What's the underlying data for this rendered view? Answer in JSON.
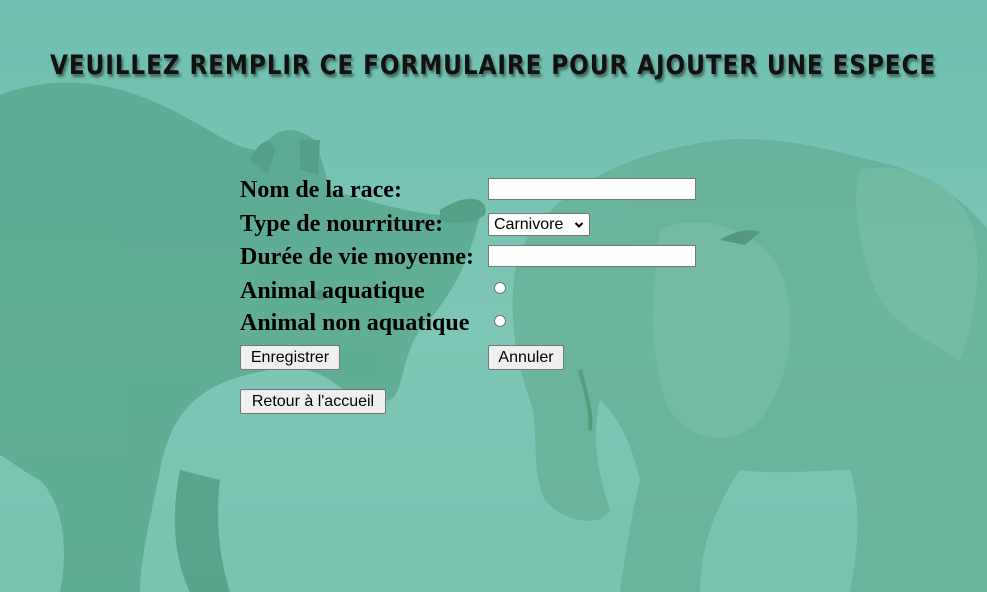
{
  "page": {
    "title": "VEUILLEZ REMPLIR CE FORMULAIRE POUR AJOUTER UNE ESPECE"
  },
  "form": {
    "race_label": "Nom de la race:",
    "race_value": "",
    "food_label": "Type de nourriture:",
    "food_selected": "Carnivore",
    "lifespan_label": "Durée de vie moyenne:",
    "lifespan_value": "",
    "aquatic_label": "Animal aquatique",
    "aquatic_checked": false,
    "non_aquatic_label": "Animal non aquatique",
    "non_aquatic_checked": false,
    "save_button": "Enregistrer",
    "cancel_button": "Annuler",
    "home_button": "Retour à l'accueil"
  },
  "background": {
    "description_icons": [
      "rhino-illustration",
      "elephant-illustration"
    ],
    "base_color": "#76c3b2",
    "art_color": "#3f8f76"
  }
}
